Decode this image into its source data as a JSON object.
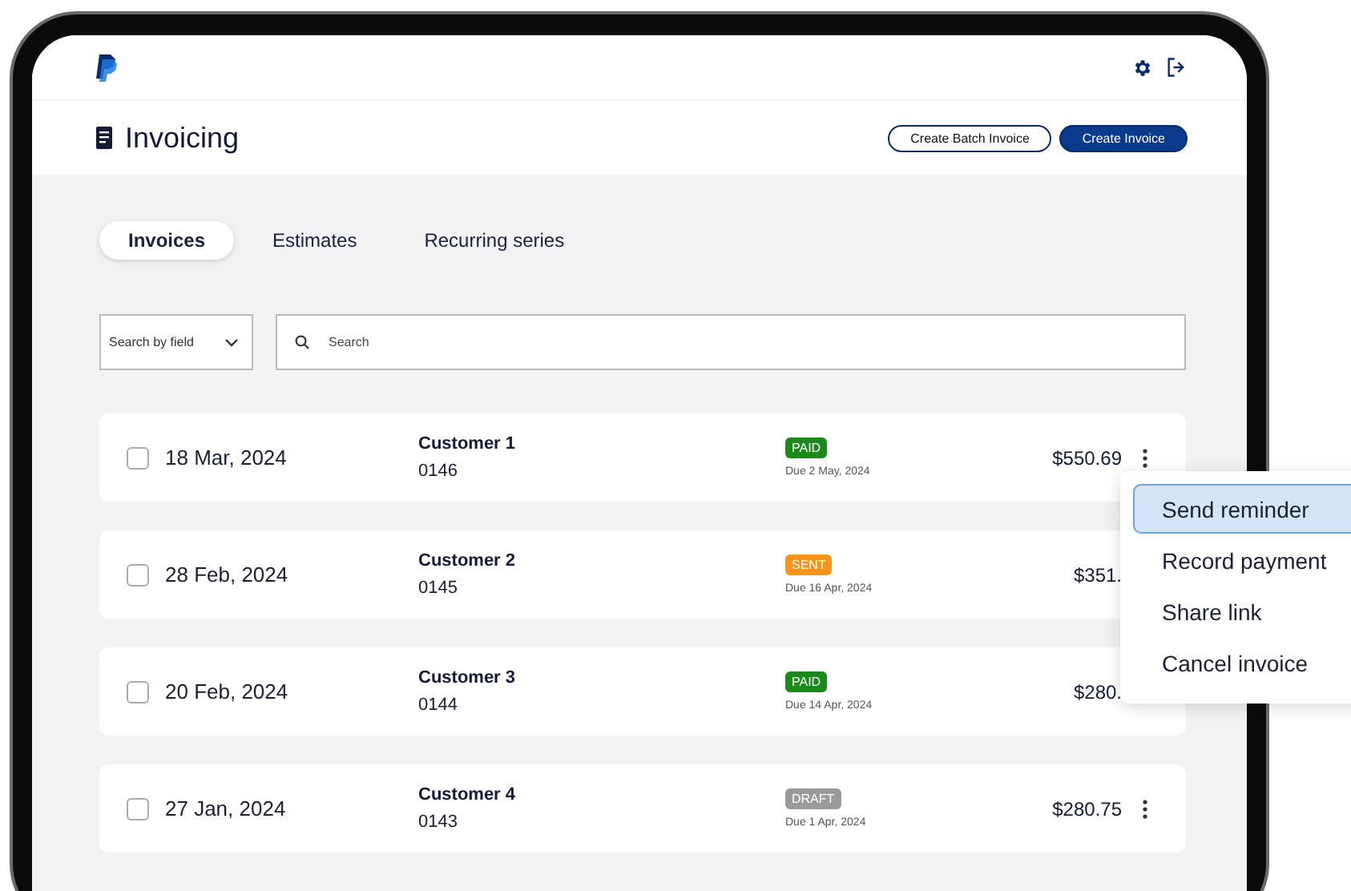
{
  "header": {
    "title": "Invoicing",
    "buttons": [
      {
        "label": "Create Batch Invoice",
        "kind": "outline"
      },
      {
        "label": "Create Invoice",
        "kind": "primary"
      }
    ]
  },
  "tabs": [
    {
      "label": "Invoices",
      "selected": true
    },
    {
      "label": "Estimates",
      "selected": false
    },
    {
      "label": "Recurring series",
      "selected": false
    }
  ],
  "filter": {
    "value": "Search by field"
  },
  "search": {
    "placeholder": "Search"
  },
  "invoices": [
    {
      "checked": false,
      "date": "18 Mar, 2024",
      "customer": "Customer 1",
      "number": "0146",
      "status": "PAID",
      "color": "#1a8a1a",
      "due": "Due  2 May, 2024",
      "amount": "$550.69",
      "menu_button": true
    },
    {
      "checked": false,
      "date": "28 Feb, 2024",
      "customer": "Customer 2",
      "number": "0145",
      "status": "SENT",
      "color": "#f7941d",
      "due": "Due 16 Apr, 2024",
      "amount": "$351.",
      "menu_button": false
    },
    {
      "checked": false,
      "date": "20 Feb, 2024",
      "customer": "Customer 3",
      "number": "0144",
      "status": "PAID",
      "color": "#1a8a1a",
      "due": "Due 14 Apr, 2024",
      "amount": "$280.",
      "menu_button": false
    },
    {
      "checked": false,
      "date": "27 Jan, 2024",
      "customer": "Customer 4",
      "number": "0143",
      "status": "DRAFT",
      "color": "#9a9a9a",
      "due": "Due 1 Apr, 2024",
      "amount": "$280.75",
      "menu_button": true
    }
  ],
  "context_menu": [
    {
      "label": "Send reminder",
      "selected": true
    },
    {
      "label": "Record payment",
      "selected": false
    },
    {
      "label": "Share link",
      "selected": false
    },
    {
      "label": "Cancel invoice",
      "selected": false
    }
  ]
}
